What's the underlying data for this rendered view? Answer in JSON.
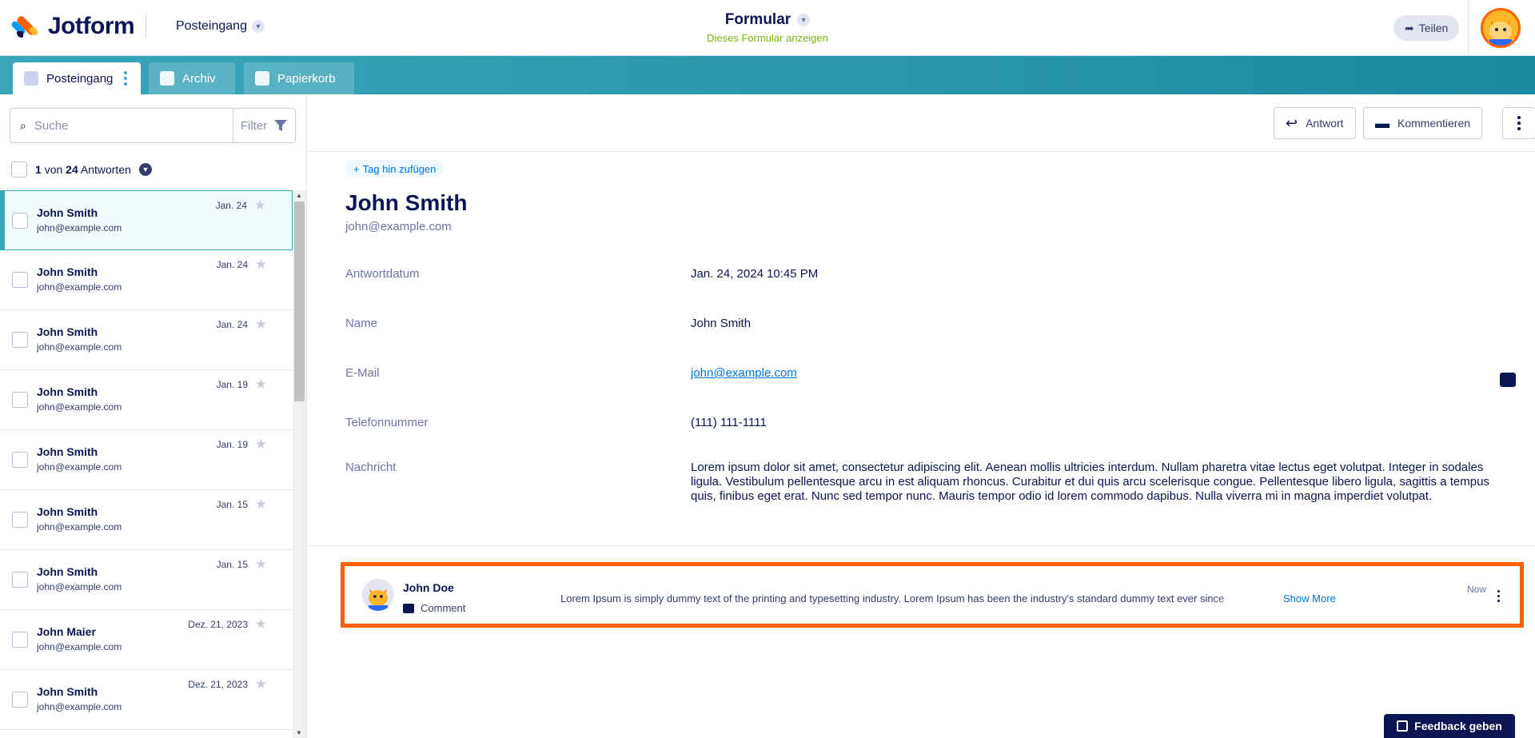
{
  "header": {
    "logo_text": "Jotform",
    "inbox_switch": "Posteingang",
    "form_title": "Formular",
    "form_link": "Dieses Formular anzeigen",
    "share_label": "Teilen"
  },
  "tabs": [
    {
      "label": "Posteingang",
      "icon": "inbox-icon"
    },
    {
      "label": "Archiv",
      "icon": "archive-icon"
    },
    {
      "label": "Papierkorb",
      "icon": "trash-icon"
    }
  ],
  "sidebar": {
    "search_placeholder": "Suche",
    "filter_label": "Filter",
    "count": {
      "current": "1",
      "sep": "von",
      "total": "24",
      "suffix": "Antworten"
    },
    "items": [
      {
        "name": "John Smith",
        "email": "john@example.com",
        "date": "Jan. 24",
        "selected": true
      },
      {
        "name": "John Smith",
        "email": "john@example.com",
        "date": "Jan. 24"
      },
      {
        "name": "John Smith",
        "email": "john@example.com",
        "date": "Jan. 24"
      },
      {
        "name": "John Smith",
        "email": "john@example.com",
        "date": "Jan. 19"
      },
      {
        "name": "John Smith",
        "email": "john@example.com",
        "date": "Jan. 19"
      },
      {
        "name": "John Smith",
        "email": "john@example.com",
        "date": "Jan. 15"
      },
      {
        "name": "John Smith",
        "email": "john@example.com",
        "date": "Jan. 15"
      },
      {
        "name": "John Maier",
        "email": "john@example.com",
        "date": "Dez. 21, 2023"
      },
      {
        "name": "John Smith",
        "email": "john@example.com",
        "date": "Dez. 21, 2023"
      }
    ]
  },
  "toolbar": {
    "reply_label": "Antwort",
    "comment_label": "Kommentieren"
  },
  "submission": {
    "tag_label": "Tag hin zufügen",
    "name": "John Smith",
    "email": "john@example.com",
    "fields": [
      {
        "label": "Antwortdatum",
        "value": "Jan. 24, 2024 10:45 PM"
      },
      {
        "label": "Name",
        "value": "John Smith"
      },
      {
        "label": "E-Mail",
        "value": "john@example.com",
        "link": true
      },
      {
        "label": "Telefonnummer",
        "value": "(111) 111-1111"
      },
      {
        "label": "Nachricht",
        "value": "Lorem ipsum dolor sit amet, consectetur adipiscing elit. Aenean mollis ultricies interdum. Nullam pharetra vitae lectus eget volutpat. Integer in sodales ligula. Vestibulum pellentesque arcu in est aliquam rhoncus. Curabitur et dui quis arcu scelerisque congue. Pellentesque libero ligula, sagittis a tempus quis, finibus eget erat. Nunc sed tempor nunc. Mauris tempor odio id lorem commodo dapibus. Nulla viverra mi in magna imperdiet volutpat."
      }
    ]
  },
  "comment": {
    "author": "John Doe",
    "type": "Comment",
    "text": "Lorem Ipsum is simply dummy text of the printing and typesetting industry. Lorem Ipsum has been the industry's standard dummy text ever since",
    "show_more": "Show More",
    "time": "Now"
  },
  "feedback_label": "Feedback geben",
  "colors": {
    "accent": "#ff6100",
    "teal": "#3aa6b9",
    "navy": "#0a1551",
    "link": "#0075e3",
    "green": "#78bb07"
  }
}
